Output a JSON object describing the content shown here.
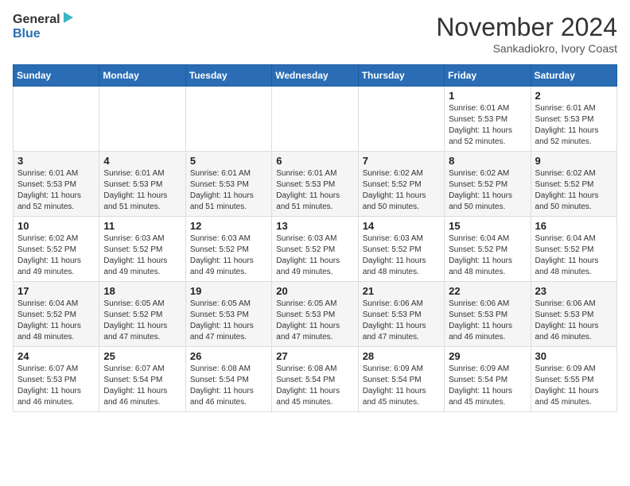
{
  "header": {
    "logo_general": "General",
    "logo_blue": "Blue",
    "month_title": "November 2024",
    "location": "Sankadiokro, Ivory Coast"
  },
  "calendar": {
    "days_of_week": [
      "Sunday",
      "Monday",
      "Tuesday",
      "Wednesday",
      "Thursday",
      "Friday",
      "Saturday"
    ],
    "weeks": [
      [
        {
          "day": "",
          "info": ""
        },
        {
          "day": "",
          "info": ""
        },
        {
          "day": "",
          "info": ""
        },
        {
          "day": "",
          "info": ""
        },
        {
          "day": "",
          "info": ""
        },
        {
          "day": "1",
          "info": "Sunrise: 6:01 AM\nSunset: 5:53 PM\nDaylight: 11 hours and 52 minutes."
        },
        {
          "day": "2",
          "info": "Sunrise: 6:01 AM\nSunset: 5:53 PM\nDaylight: 11 hours and 52 minutes."
        }
      ],
      [
        {
          "day": "3",
          "info": "Sunrise: 6:01 AM\nSunset: 5:53 PM\nDaylight: 11 hours and 52 minutes."
        },
        {
          "day": "4",
          "info": "Sunrise: 6:01 AM\nSunset: 5:53 PM\nDaylight: 11 hours and 51 minutes."
        },
        {
          "day": "5",
          "info": "Sunrise: 6:01 AM\nSunset: 5:53 PM\nDaylight: 11 hours and 51 minutes."
        },
        {
          "day": "6",
          "info": "Sunrise: 6:01 AM\nSunset: 5:53 PM\nDaylight: 11 hours and 51 minutes."
        },
        {
          "day": "7",
          "info": "Sunrise: 6:02 AM\nSunset: 5:52 PM\nDaylight: 11 hours and 50 minutes."
        },
        {
          "day": "8",
          "info": "Sunrise: 6:02 AM\nSunset: 5:52 PM\nDaylight: 11 hours and 50 minutes."
        },
        {
          "day": "9",
          "info": "Sunrise: 6:02 AM\nSunset: 5:52 PM\nDaylight: 11 hours and 50 minutes."
        }
      ],
      [
        {
          "day": "10",
          "info": "Sunrise: 6:02 AM\nSunset: 5:52 PM\nDaylight: 11 hours and 49 minutes."
        },
        {
          "day": "11",
          "info": "Sunrise: 6:03 AM\nSunset: 5:52 PM\nDaylight: 11 hours and 49 minutes."
        },
        {
          "day": "12",
          "info": "Sunrise: 6:03 AM\nSunset: 5:52 PM\nDaylight: 11 hours and 49 minutes."
        },
        {
          "day": "13",
          "info": "Sunrise: 6:03 AM\nSunset: 5:52 PM\nDaylight: 11 hours and 49 minutes."
        },
        {
          "day": "14",
          "info": "Sunrise: 6:03 AM\nSunset: 5:52 PM\nDaylight: 11 hours and 48 minutes."
        },
        {
          "day": "15",
          "info": "Sunrise: 6:04 AM\nSunset: 5:52 PM\nDaylight: 11 hours and 48 minutes."
        },
        {
          "day": "16",
          "info": "Sunrise: 6:04 AM\nSunset: 5:52 PM\nDaylight: 11 hours and 48 minutes."
        }
      ],
      [
        {
          "day": "17",
          "info": "Sunrise: 6:04 AM\nSunset: 5:52 PM\nDaylight: 11 hours and 48 minutes."
        },
        {
          "day": "18",
          "info": "Sunrise: 6:05 AM\nSunset: 5:52 PM\nDaylight: 11 hours and 47 minutes."
        },
        {
          "day": "19",
          "info": "Sunrise: 6:05 AM\nSunset: 5:53 PM\nDaylight: 11 hours and 47 minutes."
        },
        {
          "day": "20",
          "info": "Sunrise: 6:05 AM\nSunset: 5:53 PM\nDaylight: 11 hours and 47 minutes."
        },
        {
          "day": "21",
          "info": "Sunrise: 6:06 AM\nSunset: 5:53 PM\nDaylight: 11 hours and 47 minutes."
        },
        {
          "day": "22",
          "info": "Sunrise: 6:06 AM\nSunset: 5:53 PM\nDaylight: 11 hours and 46 minutes."
        },
        {
          "day": "23",
          "info": "Sunrise: 6:06 AM\nSunset: 5:53 PM\nDaylight: 11 hours and 46 minutes."
        }
      ],
      [
        {
          "day": "24",
          "info": "Sunrise: 6:07 AM\nSunset: 5:53 PM\nDaylight: 11 hours and 46 minutes."
        },
        {
          "day": "25",
          "info": "Sunrise: 6:07 AM\nSunset: 5:54 PM\nDaylight: 11 hours and 46 minutes."
        },
        {
          "day": "26",
          "info": "Sunrise: 6:08 AM\nSunset: 5:54 PM\nDaylight: 11 hours and 46 minutes."
        },
        {
          "day": "27",
          "info": "Sunrise: 6:08 AM\nSunset: 5:54 PM\nDaylight: 11 hours and 45 minutes."
        },
        {
          "day": "28",
          "info": "Sunrise: 6:09 AM\nSunset: 5:54 PM\nDaylight: 11 hours and 45 minutes."
        },
        {
          "day": "29",
          "info": "Sunrise: 6:09 AM\nSunset: 5:54 PM\nDaylight: 11 hours and 45 minutes."
        },
        {
          "day": "30",
          "info": "Sunrise: 6:09 AM\nSunset: 5:55 PM\nDaylight: 11 hours and 45 minutes."
        }
      ]
    ]
  }
}
